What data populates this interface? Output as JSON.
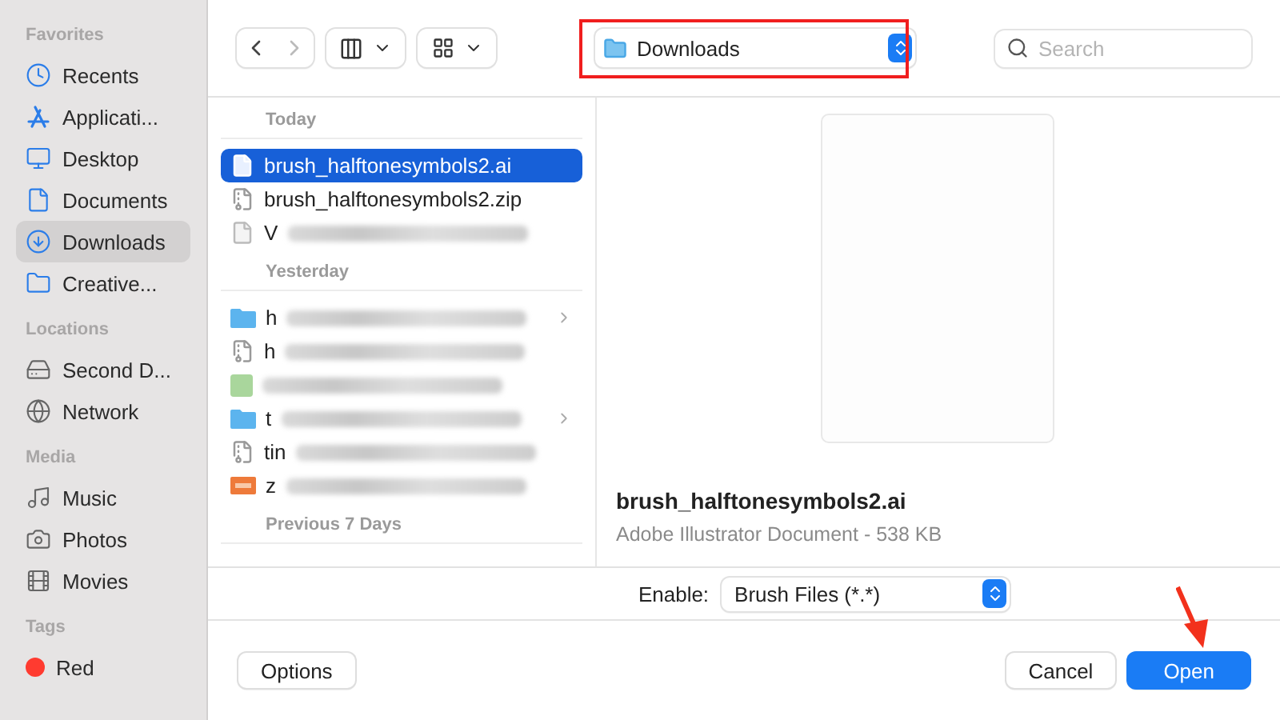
{
  "sidebar": [
    {
      "header": "Favorites",
      "items": [
        {
          "label": "Recents",
          "kind": "clock",
          "selected": false
        },
        {
          "label": "Applicati...",
          "kind": "apps",
          "selected": false
        },
        {
          "label": "Desktop",
          "kind": "desktop",
          "selected": false
        },
        {
          "label": "Documents",
          "kind": "document",
          "selected": false
        },
        {
          "label": "Downloads",
          "kind": "download",
          "selected": true
        },
        {
          "label": "Creative...",
          "kind": "folder",
          "selected": false
        }
      ]
    },
    {
      "header": "Locations",
      "items": [
        {
          "label": "Second D...",
          "kind": "drive",
          "selected": false
        },
        {
          "label": "Network",
          "kind": "globe",
          "selected": false
        }
      ]
    },
    {
      "header": "Media",
      "items": [
        {
          "label": "Music",
          "kind": "music",
          "selected": false
        },
        {
          "label": "Photos",
          "kind": "camera",
          "selected": false
        },
        {
          "label": "Movies",
          "kind": "film",
          "selected": false
        }
      ]
    },
    {
      "header": "Tags",
      "items": [
        {
          "label": "Red",
          "kind": "tag",
          "color": "#ff3b30",
          "selected": false
        }
      ]
    }
  ],
  "location": {
    "label": "Downloads"
  },
  "search": {
    "placeholder": "Search"
  },
  "file_groups": [
    {
      "header": "Today",
      "files": [
        {
          "name": "brush_halftonesymbols2.ai",
          "kind": "document",
          "blurred": false,
          "selected": true
        },
        {
          "name": "brush_halftonesymbols2.zip",
          "kind": "zip",
          "blurred": false,
          "selected": false
        },
        {
          "name": "V",
          "kind": "document",
          "blurred": true,
          "selected": false
        }
      ]
    },
    {
      "header": "Yesterday",
      "files": [
        {
          "name": "h",
          "kind": "folder",
          "blurred": true,
          "selected": false
        },
        {
          "name": "h",
          "kind": "zip",
          "blurred": true,
          "selected": false
        },
        {
          "kind": "image",
          "blurred": true,
          "selected": false
        },
        {
          "name": "t",
          "kind": "folder",
          "blurred": true,
          "selected": false
        },
        {
          "name": "tin",
          "kind": "zip",
          "blurred": true,
          "selected": false
        },
        {
          "name": "z",
          "kind": "png",
          "blurred": true,
          "selected": false
        }
      ]
    },
    {
      "header": "Previous 7 Days"
    }
  ],
  "preview": {
    "name": "brush_halftonesymbols2.ai",
    "info": "Adobe Illustrator Document - 538 KB"
  },
  "enable": {
    "label": "Enable:",
    "value": "Brush Files (*.*)"
  },
  "buttons": {
    "options": "Options",
    "cancel": "Cancel",
    "open": "Open"
  }
}
